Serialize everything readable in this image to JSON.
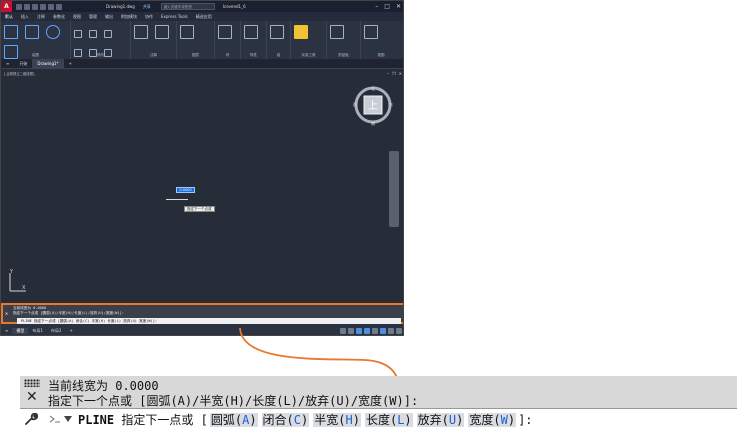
{
  "titlebar": {
    "doc_title": "Drawing1.dwg",
    "share": "共享",
    "search_placeholder": "键入关键字或短语",
    "user": "Icevend1_6"
  },
  "menu": [
    "默认",
    "插入",
    "注释",
    "参数化",
    "视图",
    "管理",
    "输出",
    "附加模块",
    "协作",
    "Express Tools",
    "精选应用"
  ],
  "ribbon": {
    "groups": [
      "绘图",
      "修改",
      "注释",
      "图层",
      "块",
      "特性",
      "组",
      "实用工具",
      "剪贴板",
      "视图"
    ],
    "tools": [
      "直线",
      "多段线",
      "圆",
      "圆弧",
      "文字",
      "标注",
      "图层特性",
      "插入",
      "特性匹配",
      "测量",
      "粘贴",
      "基点"
    ]
  },
  "doctabs": [
    "开始",
    "Drawing1*"
  ],
  "viewport": {
    "label": "[-][俯视][二维线框]",
    "viewcube_face": "上",
    "compass": {
      "n": "北",
      "s": "南",
      "e": "东",
      "w": "西"
    },
    "coord_value": "0.0000",
    "tooltip": "指定下一个点或",
    "ucs_x": "X",
    "ucs_y": "Y"
  },
  "statusbar": {
    "tabs": [
      "模型",
      "布局1",
      "布局2"
    ],
    "scale": "1:1"
  },
  "command_line": {
    "history_line1": "当前线宽为 0.0000",
    "history_line2": "指定下一个点或 [圆弧(A)/半宽(H)/长度(L)/放弃(U)/宽度(W)]:",
    "command_name": "PLINE",
    "prompt": "指定下一点或",
    "open_bracket": "[",
    "close_bracket": "]:",
    "options": [
      {
        "label": "圆弧(",
        "key": "A",
        "close": ")"
      },
      {
        "label": "闭合(",
        "key": "C",
        "close": ")"
      },
      {
        "label": "半宽(",
        "key": "H",
        "close": ")"
      },
      {
        "label": "长度(",
        "key": "L",
        "close": ")"
      },
      {
        "label": "放弃(",
        "key": "U",
        "close": ")"
      },
      {
        "label": "宽度(",
        "key": "W",
        "close": ")"
      }
    ],
    "small_input": "PLINE 指定下一点或 [圆弧(A) 闭合(C) 半宽(H) 长度(L) 放弃(U) 宽度(W)]:"
  },
  "colors": {
    "accent": "#e8782c",
    "option_key": "#1a5fd0",
    "app_bg": "#262c38"
  }
}
